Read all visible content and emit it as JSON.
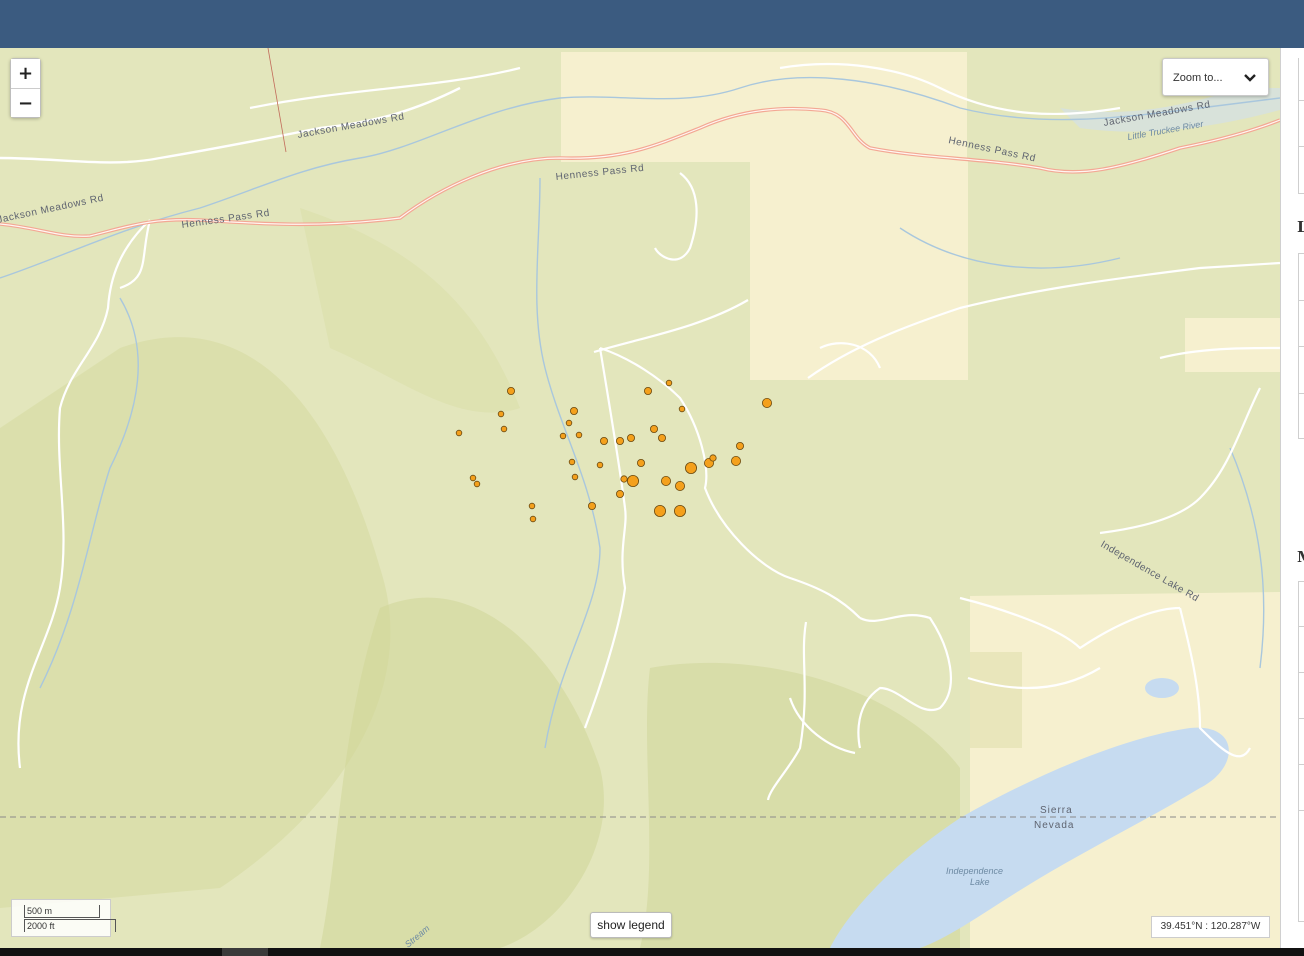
{
  "map_controls": {
    "zoom_in": "+",
    "zoom_out": "−",
    "zoom_to_label": "Zoom to...",
    "show_legend": "show legend",
    "coordinates": "39.451°N : 120.287°W",
    "scale_metric": "500 m",
    "scale_imperial": "2000 ft"
  },
  "map_labels": {
    "jackson_meadows_rd_1": "Jackson Meadows Rd",
    "jackson_meadows_rd_2": "Jackson Meadows Rd",
    "jackson_meadows_rd_3": "Jackson Meadows Rd",
    "henness_pass_rd_1": "Henness Pass Rd",
    "henness_pass_rd_2": "Henness Pass Rd",
    "henness_pass_rd_3": "Henness Pass Rd",
    "little_truckee_river": "Little Truckee River",
    "independence_lake_rd": "Independence Lake Rd",
    "sierra": "Sierra",
    "nevada": "Nevada",
    "independence_lake_1": "Independence",
    "independence_lake_2": "Lake",
    "stream": "Stream"
  },
  "right_panel": {
    "letter_1": "L",
    "letter_2": "M"
  },
  "colors": {
    "header": "#3b5b80",
    "terrain": "#e3e6bc",
    "forest": "#d8dea8",
    "private_land": "#f6f0cf",
    "water": "#c6dbf0",
    "road_major": "#f3a894",
    "road_minor": "#ffffff",
    "stream": "#a9c7dd",
    "earthquake_fill": "#f4a01c",
    "earthquake_stroke": "#6b4a10"
  }
}
